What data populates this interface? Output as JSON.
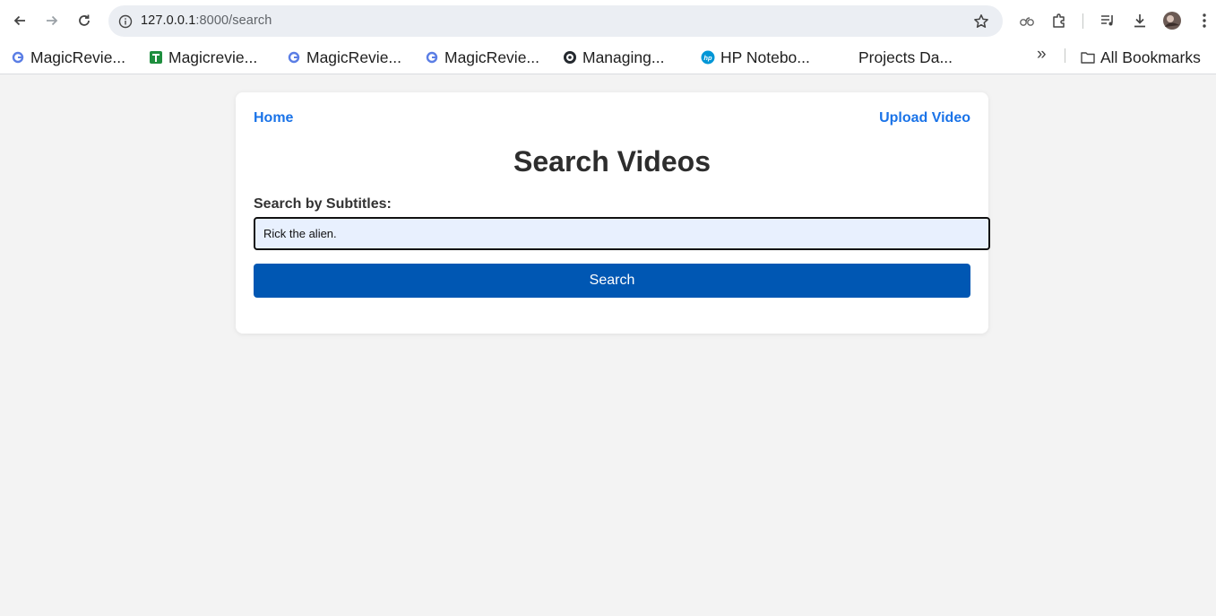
{
  "browser": {
    "url_host": "127.0.0.1",
    "url_path": ":8000/search",
    "bookmarks": [
      {
        "label": "MagicRevie..."
      },
      {
        "label": "Magicrevie..."
      },
      {
        "label": "MagicRevie..."
      },
      {
        "label": "MagicRevie..."
      },
      {
        "label": "Managing..."
      },
      {
        "label": "HP Notebo..."
      },
      {
        "label": "Projects Da..."
      }
    ],
    "more_bookmarks": "»",
    "all_bookmarks": "All Bookmarks"
  },
  "page": {
    "nav": {
      "home": "Home",
      "upload": "Upload Video"
    },
    "title": "Search Videos",
    "search_label": "Search by Subtitles:",
    "search_value": "Rick the alien.",
    "search_button": "Search"
  },
  "colors": {
    "link": "#1a73e8",
    "button": "#0057b3",
    "input_bg": "#e8f0fe",
    "page_bg": "#f3f3f3"
  }
}
